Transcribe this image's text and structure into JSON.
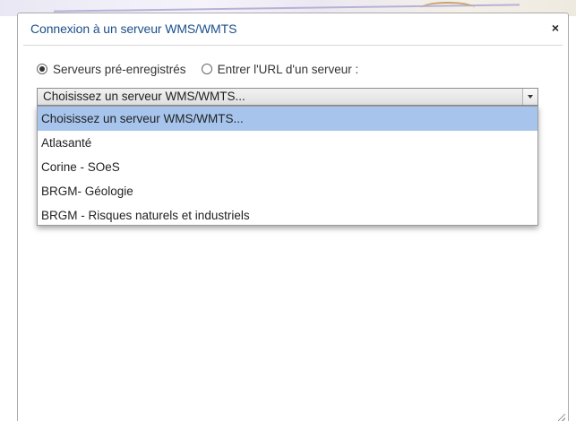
{
  "dialog": {
    "title": "Connexion à un serveur WMS/WMTS",
    "close_label": "×"
  },
  "source_mode": {
    "options": [
      {
        "label": "Serveurs pré-enregistrés",
        "checked": true
      },
      {
        "label": "Entrer l'URL d'un serveur :",
        "checked": false
      }
    ]
  },
  "server_select": {
    "selected_value": "Choisissez un serveur WMS/WMTS...",
    "options": [
      {
        "label": "Choisissez un serveur WMS/WMTS...",
        "highlighted": true
      },
      {
        "label": "Atlasanté",
        "highlighted": false
      },
      {
        "label": "Corine - SOeS",
        "highlighted": false
      },
      {
        "label": "BRGM- Géologie",
        "highlighted": false
      },
      {
        "label": "BRGM - Risques naturels et industriels",
        "highlighted": false
      }
    ]
  },
  "colors": {
    "title_text": "#1b4f8a",
    "highlight": "#a7c5ec"
  },
  "icons": {
    "close": "close-icon",
    "dropdown_arrow": "chevron-down-icon",
    "resize": "resize-grip-icon"
  }
}
